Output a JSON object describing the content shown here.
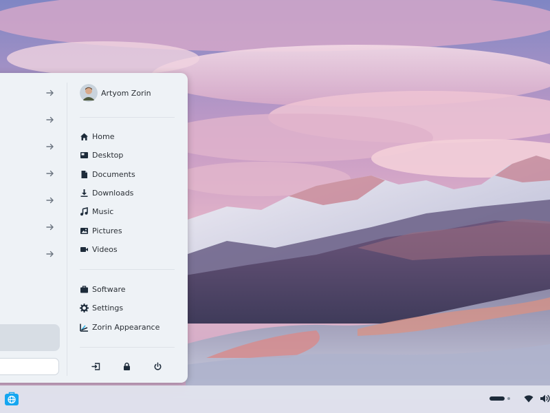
{
  "user": {
    "name": "Artyom Zorin"
  },
  "places": [
    {
      "label": "Home",
      "icon": "home-icon"
    },
    {
      "label": "Desktop",
      "icon": "desktop-icon"
    },
    {
      "label": "Documents",
      "icon": "document-icon"
    },
    {
      "label": "Downloads",
      "icon": "download-icon"
    },
    {
      "label": "Music",
      "icon": "music-note-icon"
    },
    {
      "label": "Pictures",
      "icon": "image-icon"
    },
    {
      "label": "Videos",
      "icon": "video-camera-icon"
    }
  ],
  "apps": [
    {
      "label": "Software",
      "icon": "briefcase-icon"
    },
    {
      "label": "Settings",
      "icon": "gear-icon"
    },
    {
      "label": "Zorin Appearance",
      "icon": "zorin-appearance-icon"
    }
  ],
  "system_buttons": [
    "logout-icon",
    "lock-icon",
    "power-icon"
  ],
  "search": {
    "placeholder": ""
  },
  "taskbar": {
    "start_icon": "zorin-menu-icon",
    "tray": [
      "network-wifi-icon",
      "volume-icon"
    ]
  },
  "colors": {
    "menu_bg": "#eef2f6",
    "text": "#2a2f35",
    "icon": "#1d2b3a",
    "accent": "#15a6f0"
  }
}
